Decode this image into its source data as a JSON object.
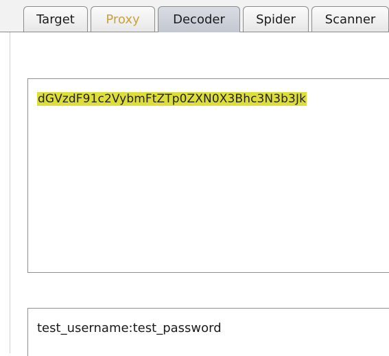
{
  "tabs": [
    {
      "label": "Target",
      "active": false
    },
    {
      "label": "Proxy",
      "active": false,
      "color": "#c9a23a"
    },
    {
      "label": "Decoder",
      "active": true
    },
    {
      "label": "Spider",
      "active": false
    },
    {
      "label": "Scanner",
      "active": false
    }
  ],
  "decoder": {
    "encoded_value": "dGVzdF91c2VybmFtZTp0ZXN0X3Bhc3N3b3Jk",
    "decoded_value": "test_username:test_password",
    "highlight_color": "#dede3a"
  }
}
